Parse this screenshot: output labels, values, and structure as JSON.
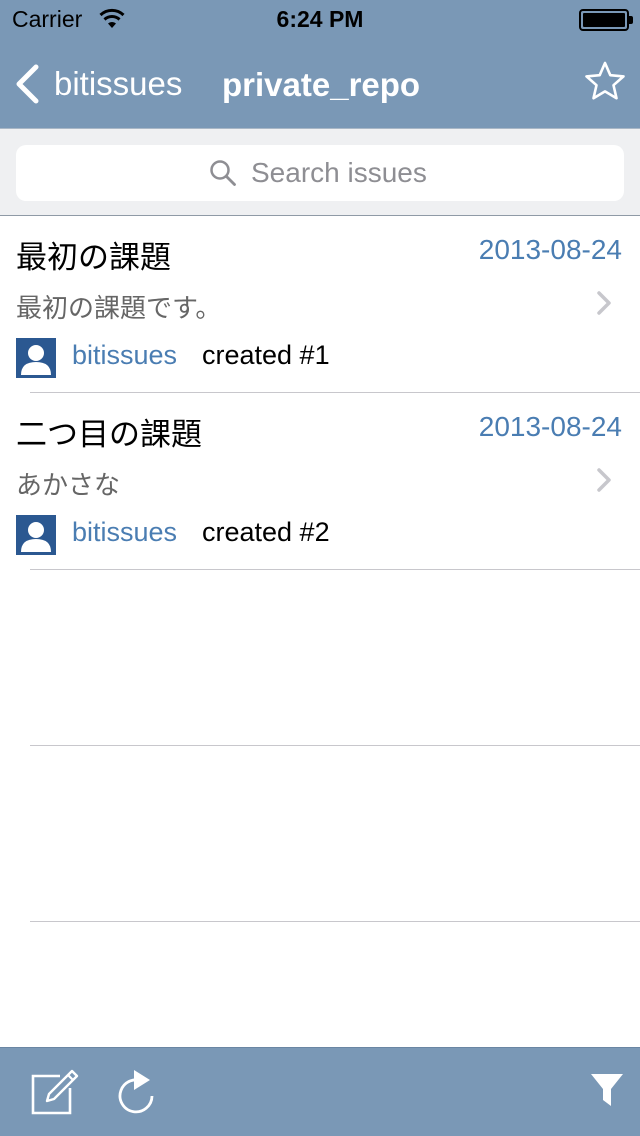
{
  "status_bar": {
    "carrier": "Carrier",
    "time": "6:24 PM"
  },
  "nav": {
    "back_label": "bitissues",
    "title": "private_repo"
  },
  "search": {
    "placeholder": "Search issues",
    "value": ""
  },
  "issues": [
    {
      "title": "最初の課題",
      "date": "2013-08-24",
      "body": "最初の課題です。",
      "user": "bitissues",
      "action": "created #1"
    },
    {
      "title": "二つ目の課題",
      "date": "2013-08-24",
      "body": "あかさな",
      "user": "bitissues",
      "action": "created #2"
    }
  ],
  "colors": {
    "bar": "#7a98b6",
    "link": "#4a7db2",
    "avatar": "#2b5891"
  },
  "icons": {
    "back": "chevron-left-icon",
    "star": "star-icon",
    "search": "search-icon",
    "compose": "compose-icon",
    "refresh": "refresh-icon",
    "filter": "filter-icon"
  }
}
